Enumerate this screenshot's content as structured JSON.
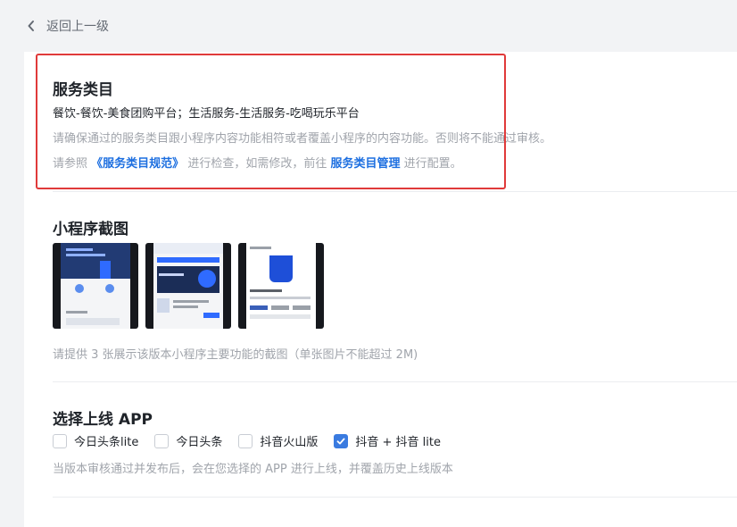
{
  "nav": {
    "back_label": "返回上一级"
  },
  "service_category": {
    "title": "服务类目",
    "categories": "餐饮-餐饮-美食团购平台；生活服务-生活服务-吃喝玩乐平台",
    "warning": "请确保通过的服务类目跟小程序内容功能相符或者覆盖小程序的内容功能。否则将不能通过审核。",
    "ref_prefix": "请参照",
    "ref_link": "《服务类目规范》",
    "ref_middle": "进行检查，如需修改，前往",
    "manage_link": "服务类目管理",
    "ref_suffix": "进行配置。"
  },
  "screenshots": {
    "title": "小程序截图",
    "hint": "请提供 3 张展示该版本小程序主要功能的截图（单张图片不能超过 2M)"
  },
  "apps": {
    "title": "选择上线 APP",
    "options": [
      {
        "label": "今日头条lite",
        "checked": false
      },
      {
        "label": "今日头条",
        "checked": false
      },
      {
        "label": "抖音火山版",
        "checked": false
      },
      {
        "label": "抖音 + 抖音 lite",
        "checked": true
      }
    ],
    "hint": "当版本审核通过并发布后，会在您选择的 APP 进行上线，并覆盖历史上线版本"
  },
  "colors": {
    "link": "#1d6fe0",
    "highlight": "#e03a3a",
    "checkbox": "#3a7be0",
    "hint": "#a0a4ab"
  }
}
